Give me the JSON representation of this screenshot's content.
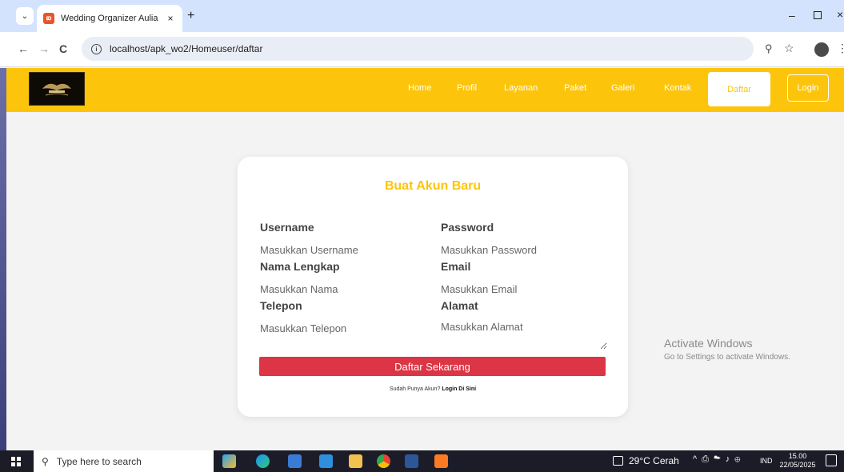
{
  "browser": {
    "tab_title": "Wedding Organizer Aulia",
    "tab_close": "×",
    "new_tab": "+",
    "tab_list": "⌄",
    "url": "localhost/apk_wo2/Homeuser/daftar",
    "back": "←",
    "forward": "→",
    "reload": "C",
    "win_minimize": "–",
    "win_close": "×"
  },
  "navbar": {
    "links": [
      "Home",
      "Profil",
      "Layanan",
      "Paket",
      "Galeri",
      "Kontak"
    ],
    "daftar_label": "Daftar",
    "login_label": "Login"
  },
  "form": {
    "title": "Buat Akun Baru",
    "username_label": "Username",
    "username_placeholder": "Masukkan Username",
    "password_label": "Password",
    "password_placeholder": "Masukkan Password",
    "nama_label": "Nama Lengkap",
    "nama_placeholder": "Masukkan Nama",
    "email_label": "Email",
    "email_placeholder": "Masukkan Email",
    "telepon_label": "Telepon",
    "telepon_placeholder": "Masukkan Telepon",
    "alamat_label": "Alamat",
    "alamat_placeholder": "Masukkan Alamat",
    "submit_label": "Daftar Sekarang",
    "login_hint": "Sudah Punya Akun?",
    "login_link": "Login Di Sini"
  },
  "watermark": {
    "title": "Activate Windows",
    "subtitle": "Go to Settings to activate Windows."
  },
  "taskbar": {
    "search_placeholder": "Type here to search",
    "weather": "29°C Cerah",
    "language": "IND",
    "time": "15.00",
    "date": "22/05/2025"
  },
  "colors": {
    "brand_yellow": "#fcc50c",
    "submit_red": "#dc3545"
  }
}
